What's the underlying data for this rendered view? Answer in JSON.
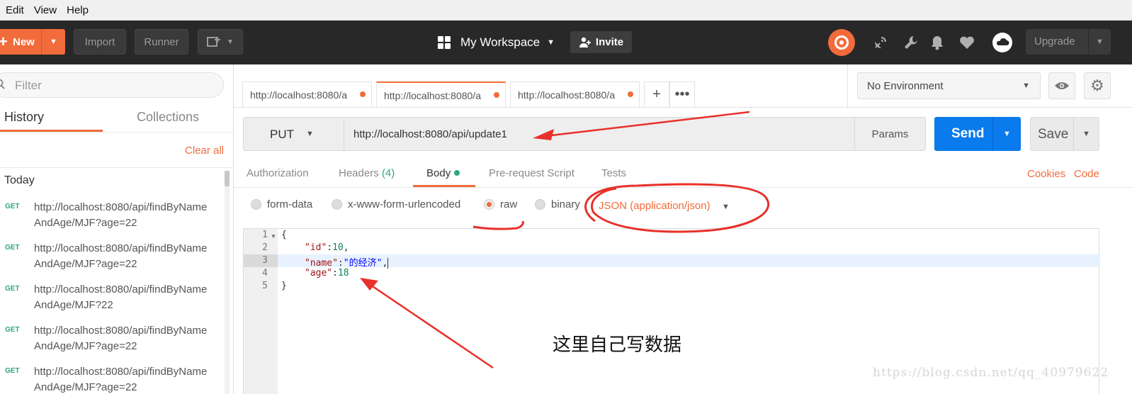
{
  "menu": {
    "edit": "Edit",
    "view": "View",
    "help": "Help"
  },
  "header": {
    "new_label": "New",
    "import_label": "Import",
    "runner_label": "Runner",
    "workspace": "My Workspace",
    "invite": "Invite",
    "upgrade": "Upgrade",
    "brand_color": "#f26b3a"
  },
  "sidebar": {
    "filter_placeholder": "Filter",
    "tab_history": "History",
    "tab_collections": "Collections",
    "clear_all": "Clear all",
    "group_today": "Today",
    "items": [
      {
        "method": "GET",
        "url": "http://localhost:8080/api/findByNameAndAge/MJF?age=22"
      },
      {
        "method": "GET",
        "url": "http://localhost:8080/api/findByNameAndAge/MJF?age=22"
      },
      {
        "method": "GET",
        "url": "http://localhost:8080/api/findByNameAndAge/MJF?22"
      },
      {
        "method": "GET",
        "url": "http://localhost:8080/api/findByNameAndAge/MJF?age=22"
      },
      {
        "method": "GET",
        "url": "http://localhost:8080/api/findByNameAndAge/MJF?age=22"
      }
    ]
  },
  "tabs": [
    {
      "title": "http://localhost:8080/a"
    },
    {
      "title": "http://localhost:8080/a"
    },
    {
      "title": "http://localhost:8080/a"
    }
  ],
  "environment": {
    "selected": "No Environment"
  },
  "request": {
    "method": "PUT",
    "url": "http://localhost:8080/api/update1",
    "params_label": "Params",
    "send_label": "Send",
    "save_label": "Save"
  },
  "subtabs": {
    "authorization": "Authorization",
    "headers": "Headers",
    "headers_count": "(4)",
    "body": "Body",
    "prerequest": "Pre-request Script",
    "tests": "Tests",
    "cookies": "Cookies",
    "code": "Code"
  },
  "body_types": {
    "form_data": "form-data",
    "urlencoded": "x-www-form-urlencoded",
    "raw": "raw",
    "binary": "binary",
    "selected": "raw",
    "content_type": "JSON (application/json)"
  },
  "editor": {
    "line_numbers": [
      "1",
      "2",
      "3",
      "4",
      "5"
    ],
    "line1": "{",
    "key_id": "\"id\"",
    "val_id": "10",
    "key_name": "\"name\"",
    "val_name": "\"的经济\"",
    "key_age": "\"age\"",
    "val_age": "18",
    "line5": "}"
  },
  "annotation": {
    "text": "这里自己写数据",
    "color": "#e8312a"
  },
  "watermark": "https://blog.csdn.net/qq_40979622"
}
